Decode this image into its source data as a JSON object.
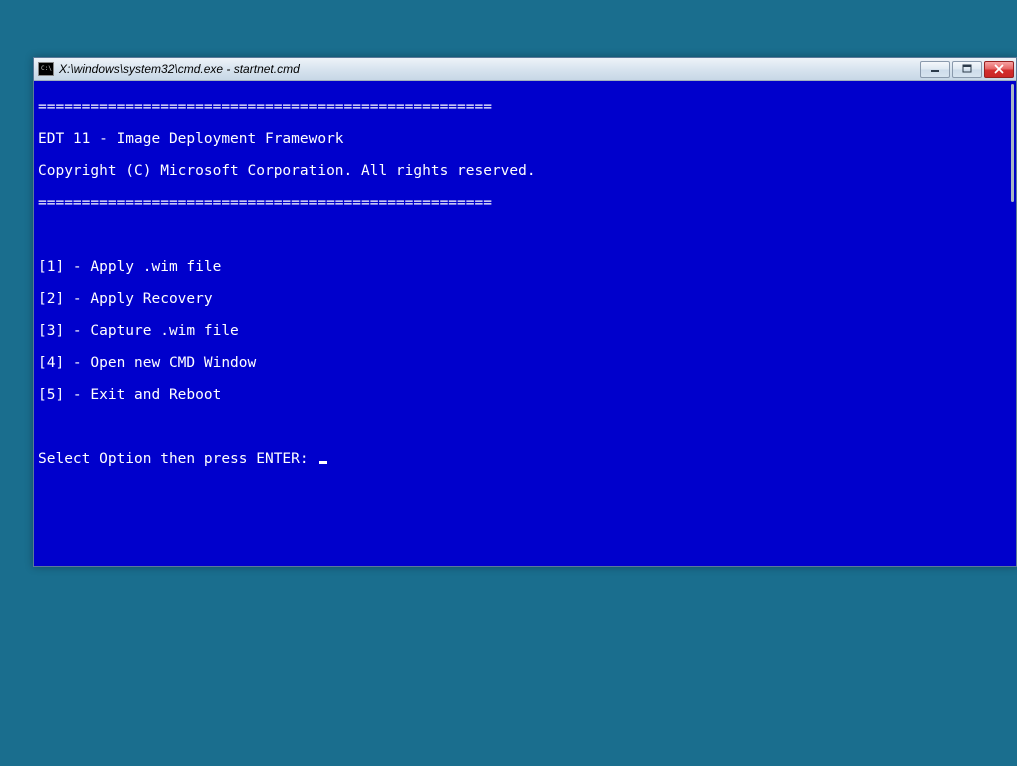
{
  "window": {
    "title": "X:\\windows\\system32\\cmd.exe - startnet.cmd"
  },
  "terminal": {
    "divider": "====================================================",
    "header1": "EDT 11 - Image Deployment Framework",
    "header2": "Copyright (C) Microsoft Corporation. All rights reserved.",
    "options": [
      "[1] - Apply .wim file",
      "[2] - Apply Recovery",
      "[3] - Capture .wim file",
      "[4] - Open new CMD Window",
      "[5] - Exit and Reboot"
    ],
    "prompt": "Select Option then press ENTER: "
  }
}
